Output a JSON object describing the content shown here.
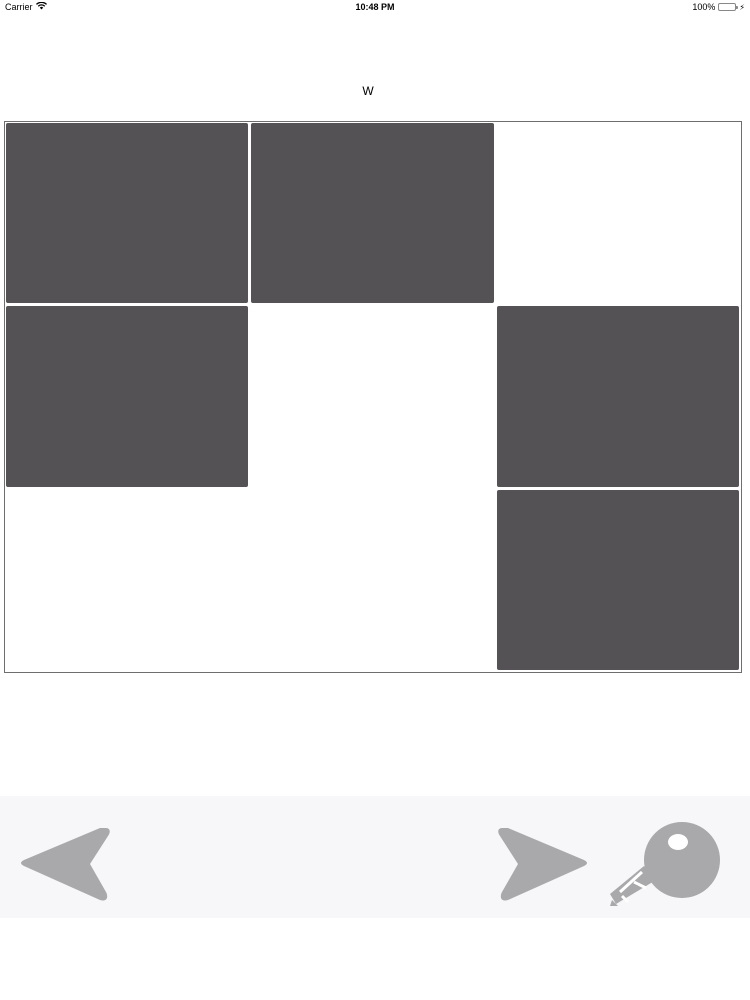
{
  "status_bar": {
    "carrier": "Carrier",
    "time": "10:48 PM",
    "battery": "100%"
  },
  "puzzle": {
    "word": "W",
    "rows": 3,
    "cols": 3,
    "cells": [
      [
        true,
        true,
        false
      ],
      [
        true,
        false,
        true
      ],
      [
        false,
        false,
        true
      ]
    ]
  },
  "toolbar": {
    "icons": {
      "back": "back-arrow-icon",
      "forward": "forward-arrow-icon",
      "speak": "microphone-icon"
    }
  },
  "colors": {
    "filled_cell": "#545255",
    "icon": "#a9a8aa",
    "toolbar_bg": "#f7f6f8"
  }
}
